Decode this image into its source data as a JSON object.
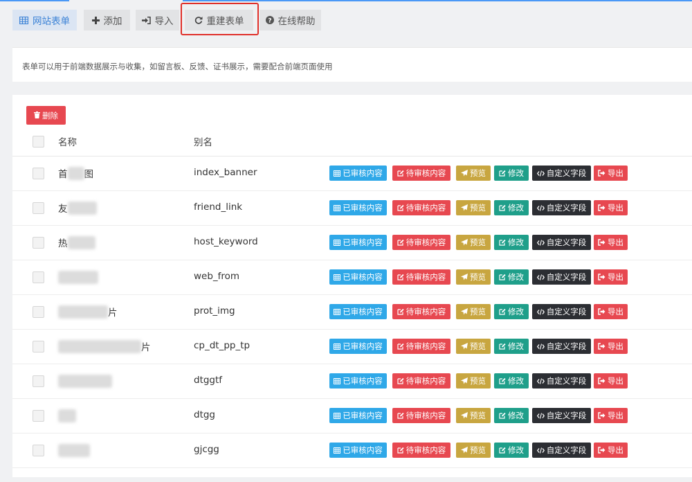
{
  "toolbar": {
    "forms_label": "网站表单",
    "add_label": "添加",
    "import_label": "导入",
    "rebuild_label": "重建表单",
    "help_label": "在线帮助"
  },
  "info": {
    "text": "表单可以用于前端数据展示与收集，如留言板、反馈、证书展示，需要配合前端页面使用"
  },
  "table": {
    "delete_label": "删除",
    "headers": {
      "name": "名称",
      "alias": "别名"
    },
    "actions": {
      "approved": "已审核内容",
      "pending": "待审核内容",
      "preview": "预览",
      "edit": "修改",
      "fields": "自定义字段",
      "export": "导出"
    },
    "rows": [
      {
        "name_start": "首",
        "name_end": "图",
        "alias": "index_banner"
      },
      {
        "name_start": "友",
        "name_end": "",
        "alias": "friend_link"
      },
      {
        "name_start": "热",
        "name_end": "",
        "alias": "host_keyword"
      },
      {
        "name_start": "",
        "name_end": "",
        "alias": "web_from"
      },
      {
        "name_start": "",
        "name_end": "片",
        "alias": "prot_img"
      },
      {
        "name_start": "",
        "name_end": "片",
        "alias": "cp_dt_pp_tp"
      },
      {
        "name_start": "",
        "name_end": "",
        "alias": "dtggtf"
      },
      {
        "name_start": "",
        "name_end": "",
        "alias": "dtgg"
      },
      {
        "name_start": "",
        "name_end": "",
        "alias": "gjcgg"
      }
    ]
  },
  "colors": {
    "primary": "#2fa8e8",
    "danger": "#e74850",
    "warning": "#c8a640",
    "success": "#1f9f8a",
    "dark": "#2c2e33",
    "highlight": "#e0302a"
  }
}
